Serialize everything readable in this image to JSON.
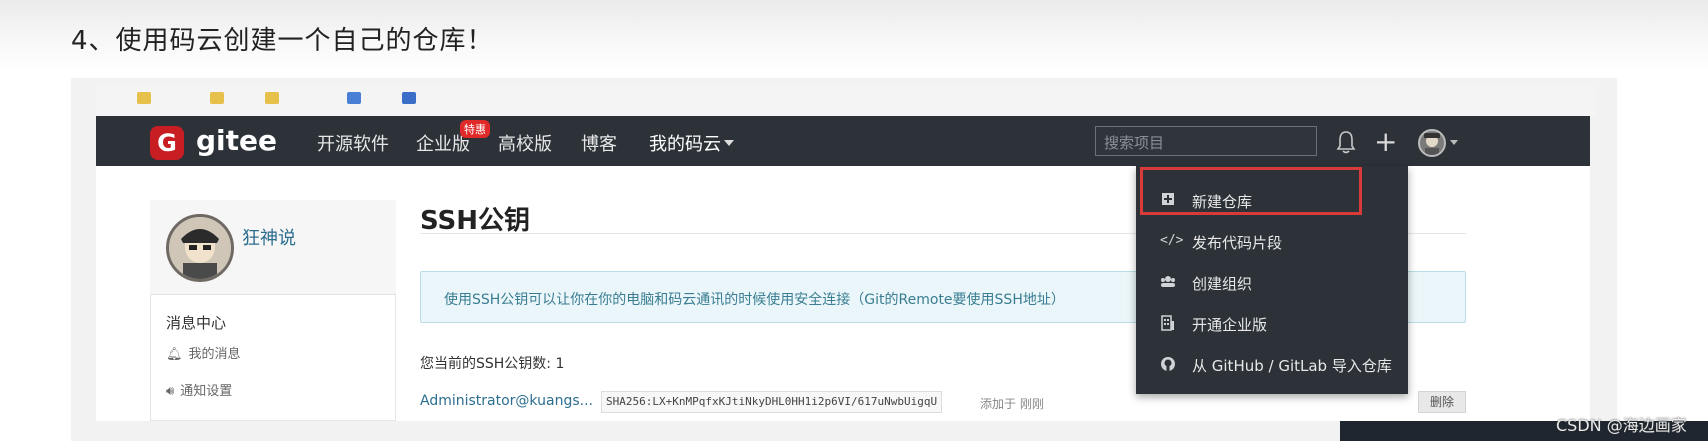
{
  "article": {
    "heading": "4、使用码云创建一个自己的仓库！"
  },
  "navbar": {
    "logo_text": "gitee",
    "links": [
      "开源软件",
      "企业版",
      "高校版",
      "博客",
      "我的码云"
    ],
    "hot_badge": "特惠",
    "search_placeholder": "搜索项目"
  },
  "sidebar": {
    "username": "狂神说",
    "section_title": "消息中心",
    "items": [
      {
        "icon": "bell-icon",
        "label": "我的消息"
      },
      {
        "icon": "speaker-icon",
        "label": "通知设置"
      }
    ]
  },
  "main": {
    "title": "SSH公钥",
    "info": "使用SSH公钥可以让你在你的电脑和码云通讯的时候使用安全连接（Git的Remote要使用SSH地址）",
    "key_count": "您当前的SSH公钥数: 1",
    "key_account": "Administrator@kuangs...",
    "fingerprint": "SHA256:LX+KnMPqfxKJtiNkyDHL0HH1i2p6VI/617uNwbUigqU",
    "added_note": "添加于 刚刚",
    "delete_label": "删除"
  },
  "dropdown": {
    "items": [
      {
        "icon": "new-repo-icon",
        "label": "新建仓库"
      },
      {
        "icon": "code-icon",
        "label": "发布代码片段"
      },
      {
        "icon": "group-icon",
        "label": "创建组织"
      },
      {
        "icon": "building-icon",
        "label": "开通企业版"
      },
      {
        "icon": "github-icon",
        "label": "从 GitHub / GitLab 导入仓库"
      }
    ]
  },
  "watermark": "CSDN @海边画家",
  "colors": {
    "nav_bg": "#2c3238",
    "logo_red": "#c71d23",
    "highlight": "#d93a3a",
    "link_blue": "#2d6e8f"
  }
}
